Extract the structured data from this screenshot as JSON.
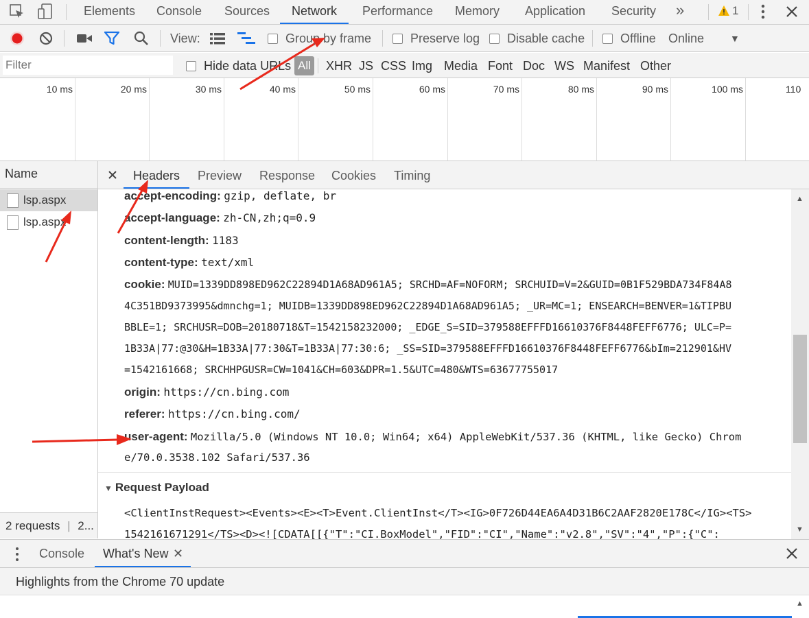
{
  "main_tabs": [
    "Elements",
    "Console",
    "Sources",
    "Network",
    "Performance",
    "Memory",
    "Application",
    "Security"
  ],
  "more_tabs": "»",
  "warnings_count": "1",
  "toolbar": {
    "view_label": "View:",
    "group_by_frame": "Group by frame",
    "preserve_log": "Preserve log",
    "disable_cache": "Disable cache",
    "offline": "Offline",
    "throttle_value": "Online"
  },
  "filter": {
    "placeholder": "Filter",
    "hide_data_urls": "Hide data URLs",
    "types": [
      "All",
      "XHR",
      "JS",
      "CSS",
      "Img",
      "Media",
      "Font",
      "Doc",
      "WS",
      "Manifest",
      "Other"
    ]
  },
  "timeline_ticks": [
    "10 ms",
    "20 ms",
    "30 ms",
    "40 ms",
    "50 ms",
    "60 ms",
    "70 ms",
    "80 ms",
    "90 ms",
    "100 ms",
    "110"
  ],
  "requests": {
    "column_name": "Name",
    "items": [
      "lsp.aspx",
      "lsp.aspx"
    ],
    "status_requests": "2 requests",
    "status_more": "2..."
  },
  "details": {
    "tabs": [
      "Headers",
      "Preview",
      "Response",
      "Cookies",
      "Timing"
    ],
    "headers": [
      {
        "name": "accept-encoding:",
        "lines": [
          "gzip, deflate, br"
        ]
      },
      {
        "name": "accept-language:",
        "lines": [
          "zh-CN,zh;q=0.9"
        ]
      },
      {
        "name": "content-length:",
        "lines": [
          "1183"
        ]
      },
      {
        "name": "content-type:",
        "lines": [
          "text/xml"
        ]
      },
      {
        "name": "cookie:",
        "lines": [
          "MUID=1339DD898ED962C22894D1A68AD961A5; SRCHD=AF=NOFORM; SRCHUID=V=2&GUID=0B1F529BDA734F84A8",
          "4C351BD9373995&dmnchg=1; MUIDB=1339DD898ED962C22894D1A68AD961A5; _UR=MC=1; ENSEARCH=BENVER=1&TIPBU",
          "BBLE=1; SRCHUSR=DOB=20180718&T=1542158232000; _EDGE_S=SID=379588EFFFD16610376F8448FEFF6776; ULC=P=",
          "1B33A|77:@30&H=1B33A|77:30&T=1B33A|77:30:6; _SS=SID=379588EFFFD16610376F8448FEFF6776&bIm=212901&HV",
          "=1542161668; SRCHHPGUSR=CW=1041&CH=603&DPR=1.5&UTC=480&WTS=63677755017"
        ]
      },
      {
        "name": "origin:",
        "lines": [
          "https://cn.bing.com"
        ]
      },
      {
        "name": "referer:",
        "lines": [
          "https://cn.bing.com/"
        ]
      },
      {
        "name": "user-agent:",
        "lines": [
          "Mozilla/5.0 (Windows NT 10.0; Win64; x64) AppleWebKit/537.36 (KHTML, like Gecko) Chrom",
          "e/70.0.3538.102 Safari/537.36"
        ]
      }
    ],
    "payload_title": "Request Payload",
    "payload_lines": [
      "<ClientInstRequest><Events><E><T>Event.ClientInst</T><IG>0F726D44EA6A4D31B6C2AAF2820E178C</IG><TS>",
      "1542161671291</TS><D><![CDATA[[{\"T\":\"CI.BoxModel\",\"FID\":\"CI\",\"Name\":\"v2.8\",\"SV\":\"4\",\"P\":{\"C\":"
    ]
  },
  "drawer": {
    "tabs": [
      "Console",
      "What's New"
    ],
    "highlight": "Highlights from the Chrome 70 update"
  },
  "colors": {
    "record": "#e51e1e",
    "filter_active": "#1a73e8",
    "arrow": "#e8291c",
    "warning": "#f4b400"
  }
}
